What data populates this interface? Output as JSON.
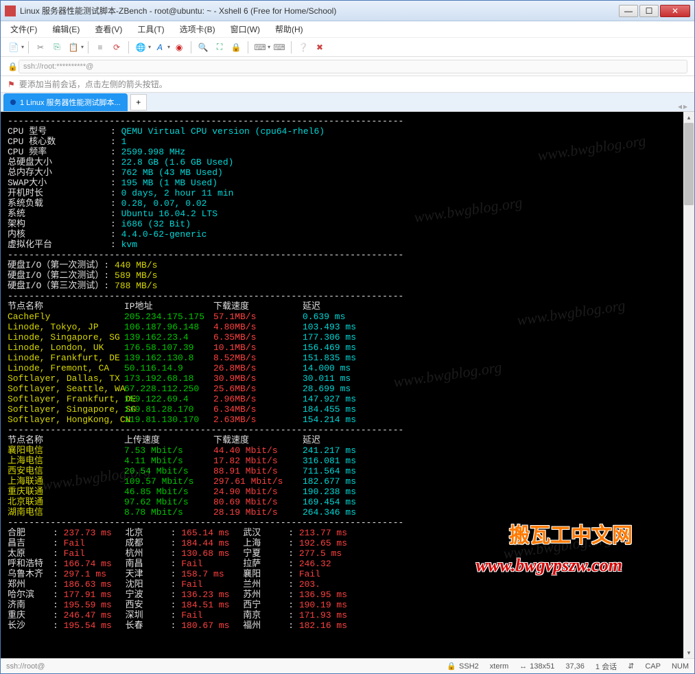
{
  "window_title": "Linux 服务器性能测试脚本-ZBench - root@ubuntu: ~ - Xshell 6 (Free for Home/School)",
  "menus": [
    "文件(F)",
    "编辑(E)",
    "查看(V)",
    "工具(T)",
    "选项卡(B)",
    "窗口(W)",
    "帮助(H)"
  ],
  "address_value": "ssh://root:**********@",
  "hint_text": "要添加当前会话，点击左侧的箭头按钮。",
  "tab_label": "1 Linux 服务器性能测试脚本...",
  "sysinfo": [
    {
      "k": "CPU 型号",
      "v": "QEMU Virtual CPU version (cpu64-rhel6)"
    },
    {
      "k": "CPU 核心数",
      "v": "1"
    },
    {
      "k": "CPU 频率",
      "v": "2599.998 MHz"
    },
    {
      "k": "总硬盘大小",
      "v": "22.8 GB (1.6 GB Used)"
    },
    {
      "k": "总内存大小",
      "v": "762 MB (43 MB Used)"
    },
    {
      "k": "SWAP大小",
      "v": "195 MB (1 MB Used)"
    },
    {
      "k": "开机时长",
      "v": "0 days, 2 hour 11 min"
    },
    {
      "k": "系统负载",
      "v": "0.28, 0.07, 0.02"
    },
    {
      "k": "系统",
      "v": "Ubuntu 16.04.2 LTS"
    },
    {
      "k": "架构",
      "v": "i686 (32 Bit)"
    },
    {
      "k": "内核",
      "v": "4.4.0-62-generic"
    },
    {
      "k": "虚拟化平台",
      "v": "kvm"
    }
  ],
  "disk_io_label": "硬盘I/O",
  "disk_io": [
    {
      "t": "（第一次测试）",
      "v": "440 MB/s"
    },
    {
      "t": "（第二次测试）",
      "v": "589 MB/s"
    },
    {
      "t": "（第三次测试）",
      "v": "788 MB/s"
    }
  ],
  "net_header1": {
    "name": "节点名称",
    "ip": "IP地址",
    "down": "下载速度",
    "ping": "延迟"
  },
  "net1": [
    {
      "name": "CacheFly",
      "ip": "205.234.175.175",
      "down": "57.1MB/s",
      "ping": "0.639 ms"
    },
    {
      "name": "Linode, Tokyo, JP",
      "ip": "106.187.96.148",
      "down": "4.80MB/s",
      "ping": "103.493 ms"
    },
    {
      "name": "Linode, Singapore, SG",
      "ip": "139.162.23.4",
      "down": "6.35MB/s",
      "ping": "177.306 ms"
    },
    {
      "name": "Linode, London, UK",
      "ip": "176.58.107.39",
      "down": "10.1MB/s",
      "ping": "156.469 ms"
    },
    {
      "name": "Linode, Frankfurt, DE",
      "ip": "139.162.130.8",
      "down": "8.52MB/s",
      "ping": "151.835 ms"
    },
    {
      "name": "Linode, Fremont, CA",
      "ip": "50.116.14.9",
      "down": "26.8MB/s",
      "ping": "14.000 ms"
    },
    {
      "name": "Softlayer, Dallas, TX",
      "ip": "173.192.68.18",
      "down": "30.9MB/s",
      "ping": "30.011 ms"
    },
    {
      "name": "Softlayer, Seattle, WA",
      "ip": "67.228.112.250",
      "down": "25.6MB/s",
      "ping": "28.699 ms"
    },
    {
      "name": "Softlayer, Frankfurt, DE",
      "ip": "159.122.69.4",
      "down": "2.96MB/s",
      "ping": "147.927 ms"
    },
    {
      "name": "Softlayer, Singapore, SG",
      "ip": "119.81.28.170",
      "down": "6.34MB/s",
      "ping": "184.455 ms"
    },
    {
      "name": "Softlayer, HongKong, CN",
      "ip": "119.81.130.170",
      "down": "2.63MB/s",
      "ping": "154.214 ms"
    }
  ],
  "net_header2": {
    "name": "节点名称",
    "up": "上传速度",
    "down": "下载速度",
    "ping": "延迟"
  },
  "net2": [
    {
      "name": "襄阳电信",
      "up": "7.53 Mbit/s",
      "down": "44.40 Mbit/s",
      "ping": "241.217 ms"
    },
    {
      "name": "上海电信",
      "up": "4.11 Mbit/s",
      "down": "17.82 Mbit/s",
      "ping": "316.081 ms"
    },
    {
      "name": "西安电信",
      "up": "20.54 Mbit/s",
      "down": "88.91 Mbit/s",
      "ping": "711.564 ms"
    },
    {
      "name": "上海联通",
      "up": "109.57 Mbit/s",
      "down": "297.61 Mbit/s",
      "ping": "182.677 ms"
    },
    {
      "name": "重庆联通",
      "up": "46.85 Mbit/s",
      "down": "24.90 Mbit/s",
      "ping": "190.238 ms"
    },
    {
      "name": "北京联通",
      "up": "97.62 Mbit/s",
      "down": "80.69 Mbit/s",
      "ping": "169.454 ms"
    },
    {
      "name": "湖南电信",
      "up": "8.78 Mbit/s",
      "down": "28.19 Mbit/s",
      "ping": "264.346 ms"
    }
  ],
  "ping_rows": [
    [
      {
        "c": "合肥",
        "v": "237.73 ms"
      },
      {
        "c": "北京",
        "v": "165.14 ms"
      },
      {
        "c": "武汉",
        "v": "213.77 ms"
      }
    ],
    [
      {
        "c": "昌吉",
        "v": "Fail"
      },
      {
        "c": "成都",
        "v": "184.44 ms"
      },
      {
        "c": "上海",
        "v": "192.65 ms"
      }
    ],
    [
      {
        "c": "太原",
        "v": "Fail"
      },
      {
        "c": "杭州",
        "v": "130.68 ms"
      },
      {
        "c": "宁夏",
        "v": "277.5 ms"
      }
    ],
    [
      {
        "c": "呼和浩特",
        "v": "166.74 ms"
      },
      {
        "c": "南昌",
        "v": "Fail"
      },
      {
        "c": "拉萨",
        "v": "246.32"
      }
    ],
    [
      {
        "c": "乌鲁木齐",
        "v": "297.1 ms"
      },
      {
        "c": "天津",
        "v": "158.7 ms"
      },
      {
        "c": "襄阳",
        "v": "Fail"
      }
    ],
    [
      {
        "c": "郑州",
        "v": "186.63 ms"
      },
      {
        "c": "沈阳",
        "v": "Fail"
      },
      {
        "c": "兰州",
        "v": "203."
      }
    ],
    [
      {
        "c": "哈尔滨",
        "v": "177.91 ms"
      },
      {
        "c": "宁波",
        "v": "136.23 ms"
      },
      {
        "c": "苏州",
        "v": "136.95 ms"
      }
    ],
    [
      {
        "c": "济南",
        "v": "195.59 ms"
      },
      {
        "c": "西安",
        "v": "184.51 ms"
      },
      {
        "c": "西宁",
        "v": "190.19 ms"
      }
    ],
    [
      {
        "c": "重庆",
        "v": "246.47 ms"
      },
      {
        "c": "深圳",
        "v": "Fail"
      },
      {
        "c": "南京",
        "v": "171.93 ms"
      }
    ],
    [
      {
        "c": "长沙",
        "v": "195.54 ms"
      },
      {
        "c": "长春",
        "v": "180.67 ms"
      },
      {
        "c": "福州",
        "v": "182.16 ms"
      }
    ]
  ],
  "status": {
    "left": "ssh://root@",
    "ssh": "SSH2",
    "term": "xterm",
    "size": "138x51",
    "pos": "37,36",
    "sessions": "1 会话",
    "cap": "CAP",
    "num": "NUM"
  },
  "overlay_cn": "搬瓦工中文网",
  "overlay_url": "www.bwgvpszw.com",
  "watermark": "www.bwgblog.org"
}
